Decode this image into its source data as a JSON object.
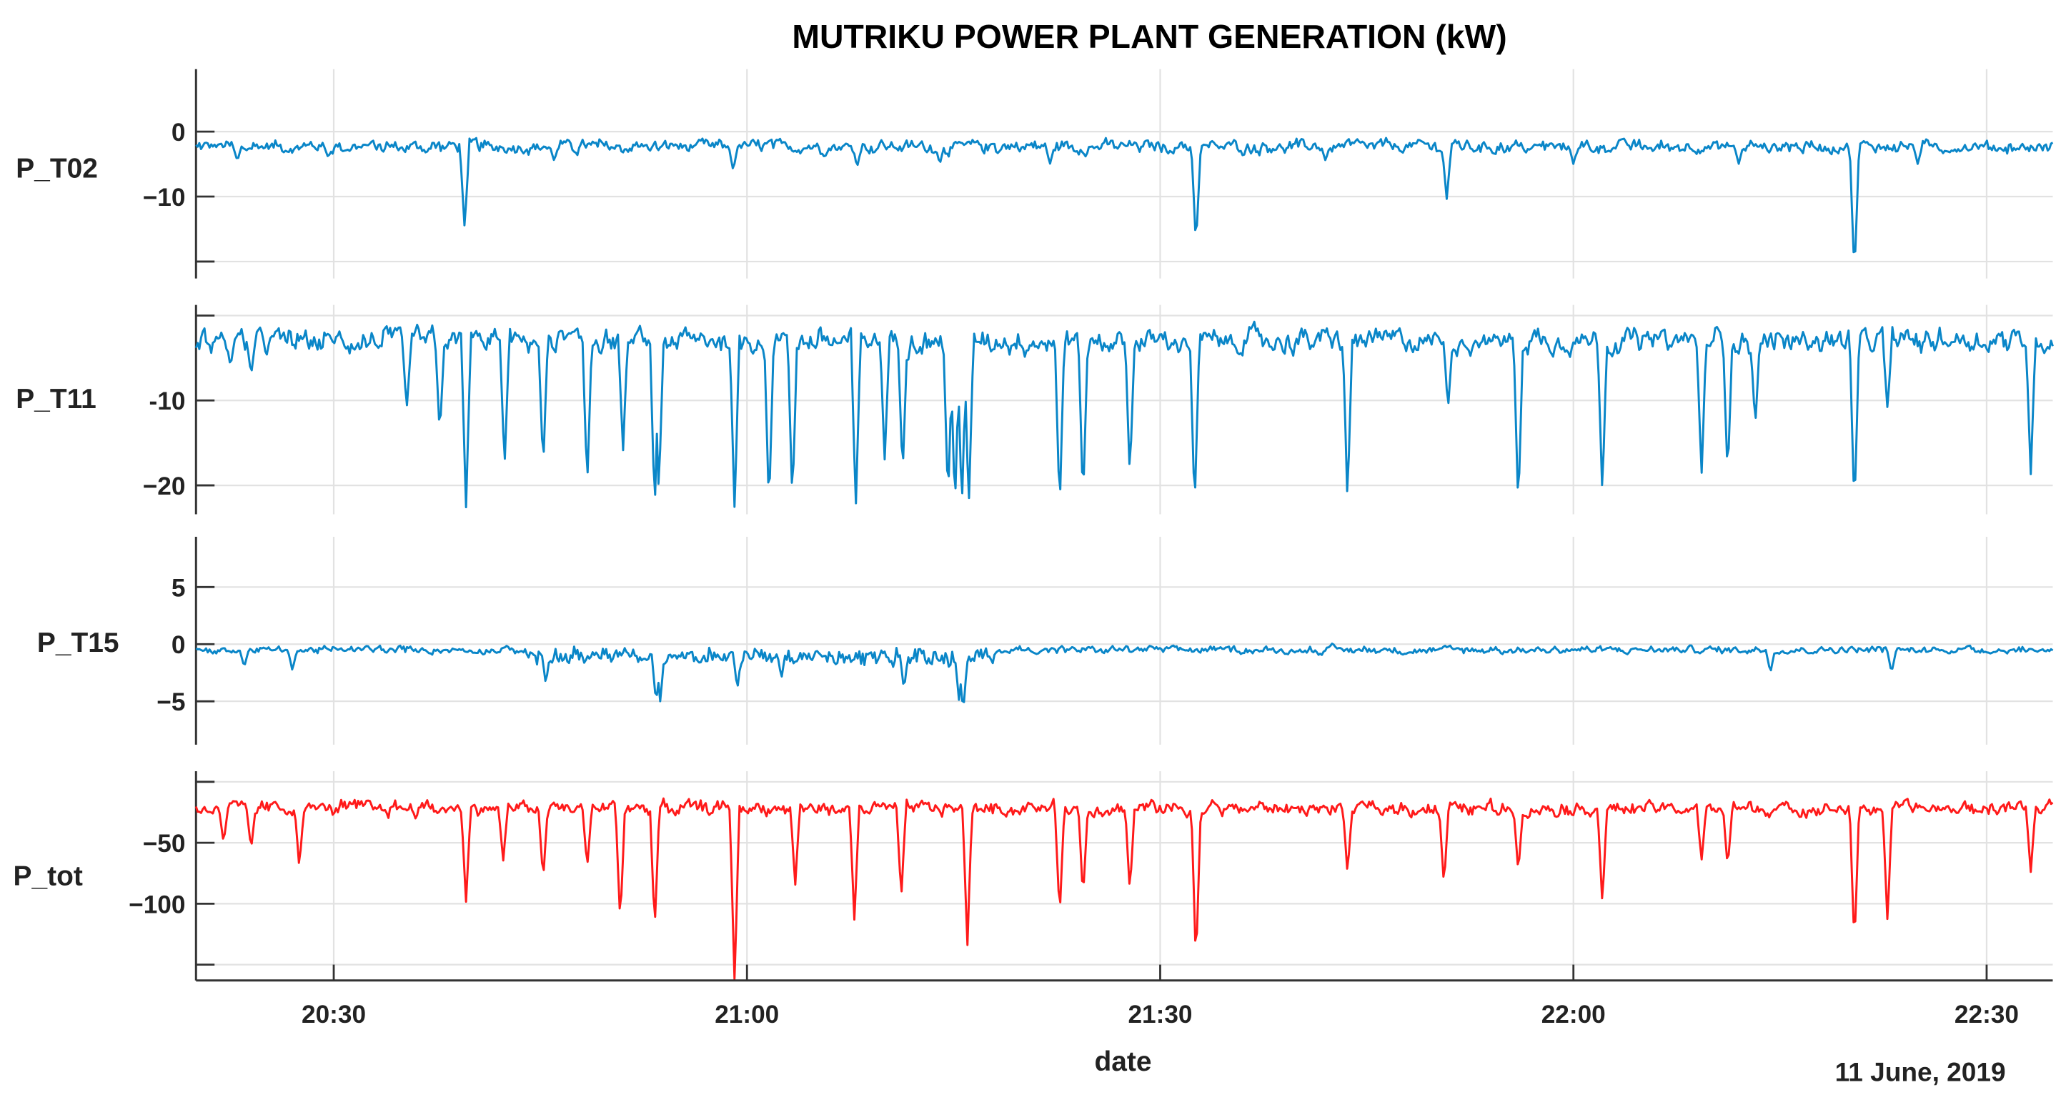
{
  "chart_data": [
    {
      "type": "line",
      "title": "MUTRIKU POWER PLANT GENERATION (kW)",
      "xlabel": "date",
      "date_note": "11 June, 2019",
      "x_unit": "minutes after 20:20",
      "xlim": [
        0,
        134.8
      ],
      "x_ticks": [
        {
          "value": 10,
          "label": "20:30"
        },
        {
          "value": 40,
          "label": "21:00"
        },
        {
          "value": 70,
          "label": "21:30"
        },
        {
          "value": 100,
          "label": "22:00"
        },
        {
          "value": 130,
          "label": "22:30"
        }
      ],
      "grid": true,
      "panels": [
        {
          "name": "P_T02",
          "color": "#0a86c8",
          "ylim": [
            -22.6,
            9.6
          ],
          "y_ticks": [
            {
              "value": 0,
              "label": "0"
            },
            {
              "value": -10,
              "label": "−10"
            },
            {
              "value": -20,
              "label": ""
            }
          ],
          "baseline": -2,
          "noise": 1.6,
          "spikes": [
            [
              19.5,
              -15
            ],
            [
              72.6,
              -17.5
            ],
            [
              90.8,
              -10.5
            ],
            [
              120.4,
              -22
            ],
            [
              3,
              -4.5
            ],
            [
              9.6,
              -4
            ],
            [
              26,
              -4.5
            ],
            [
              39,
              -6
            ],
            [
              48,
              -5.5
            ],
            [
              54,
              -5
            ],
            [
              62,
              -5
            ],
            [
              82,
              -4.5
            ],
            [
              100,
              -5
            ],
            [
              112,
              -5
            ],
            [
              125,
              -5
            ]
          ]
        },
        {
          "name": "P_T11",
          "color": "#0a86c8",
          "ylim": [
            -23.4,
            1.25
          ],
          "y_ticks": [
            {
              "value": 0,
              "label": ""
            },
            {
              "value": -10,
              "label": "-10"
            },
            {
              "value": -20,
              "label": "−20"
            }
          ],
          "baseline": -2.5,
          "noise": 2.2,
          "spikes": [
            [
              2.5,
              -6
            ],
            [
              4,
              -7
            ],
            [
              15.3,
              -11
            ],
            [
              17.7,
              -14
            ],
            [
              19.6,
              -23
            ],
            [
              22.4,
              -18
            ],
            [
              25.2,
              -18
            ],
            [
              28.4,
              -20
            ],
            [
              31.0,
              -16
            ],
            [
              33.3,
              -23
            ],
            [
              33.6,
              -21
            ],
            [
              39.1,
              -23
            ],
            [
              41.6,
              -23
            ],
            [
              43.3,
              -22
            ],
            [
              47.9,
              -23
            ],
            [
              50.0,
              -17
            ],
            [
              51.3,
              -19
            ],
            [
              54.6,
              -22
            ],
            [
              55.1,
              -23
            ],
            [
              55.6,
              -23
            ],
            [
              56.1,
              -23
            ],
            [
              62.7,
              -23
            ],
            [
              64.4,
              -22
            ],
            [
              67.8,
              -19
            ],
            [
              72.5,
              -23
            ],
            [
              83.6,
              -22
            ],
            [
              90.9,
              -11
            ],
            [
              96.0,
              -23
            ],
            [
              102.1,
              -21
            ],
            [
              109.3,
              -19
            ],
            [
              111.2,
              -19
            ],
            [
              113.2,
              -13
            ],
            [
              120.4,
              -23
            ],
            [
              122.8,
              -11
            ],
            [
              133.2,
              -19
            ]
          ]
        },
        {
          "name": "P_T15",
          "color": "#0a86c8",
          "ylim": [
            -8.8,
            9.4
          ],
          "y_ticks": [
            {
              "value": 5,
              "label": "5"
            },
            {
              "value": 0,
              "label": "0"
            },
            {
              "value": -5,
              "label": "−5"
            }
          ],
          "baseline": -0.4,
          "noise": 0.5,
          "spikes": [
            [
              3.5,
              -2
            ],
            [
              7,
              -2.3
            ],
            [
              25.4,
              -3.5
            ],
            [
              33.4,
              -5.2
            ],
            [
              33.7,
              -5
            ],
            [
              39.3,
              -4
            ],
            [
              42.5,
              -3
            ],
            [
              51.4,
              -4
            ],
            [
              55.4,
              -5
            ],
            [
              55.7,
              -6
            ],
            [
              114.3,
              -2.5
            ],
            [
              123.1,
              -2.5
            ]
          ]
        },
        {
          "name": "P_tot",
          "color": "#ff1a1a",
          "ylim": [
            -163,
            8.7
          ],
          "y_ticks": [
            {
              "value": 0,
              "label": ""
            },
            {
              "value": -50,
              "label": "−50"
            },
            {
              "value": -100,
              "label": "−100"
            },
            {
              "value": -150,
              "label": ""
            }
          ],
          "baseline": -20,
          "noise": 9,
          "spikes": [
            [
              2,
              -50
            ],
            [
              4,
              -55
            ],
            [
              7.5,
              -70
            ],
            [
              19.6,
              -100
            ],
            [
              22.3,
              -65
            ],
            [
              25.2,
              -80
            ],
            [
              28.4,
              -70
            ],
            [
              30.8,
              -115
            ],
            [
              33.3,
              -120
            ],
            [
              39.1,
              -165
            ],
            [
              43.5,
              -85
            ],
            [
              47.8,
              -115
            ],
            [
              51.2,
              -95
            ],
            [
              56.0,
              -135
            ],
            [
              62.7,
              -110
            ],
            [
              64.4,
              -95
            ],
            [
              67.8,
              -90
            ],
            [
              72.6,
              -150
            ],
            [
              83.6,
              -75
            ],
            [
              90.6,
              -85
            ],
            [
              96.0,
              -75
            ],
            [
              102.1,
              -100
            ],
            [
              109.3,
              -65
            ],
            [
              111.2,
              -70
            ],
            [
              120.4,
              -135
            ],
            [
              122.8,
              -115
            ],
            [
              133.2,
              -75
            ]
          ]
        }
      ]
    }
  ]
}
